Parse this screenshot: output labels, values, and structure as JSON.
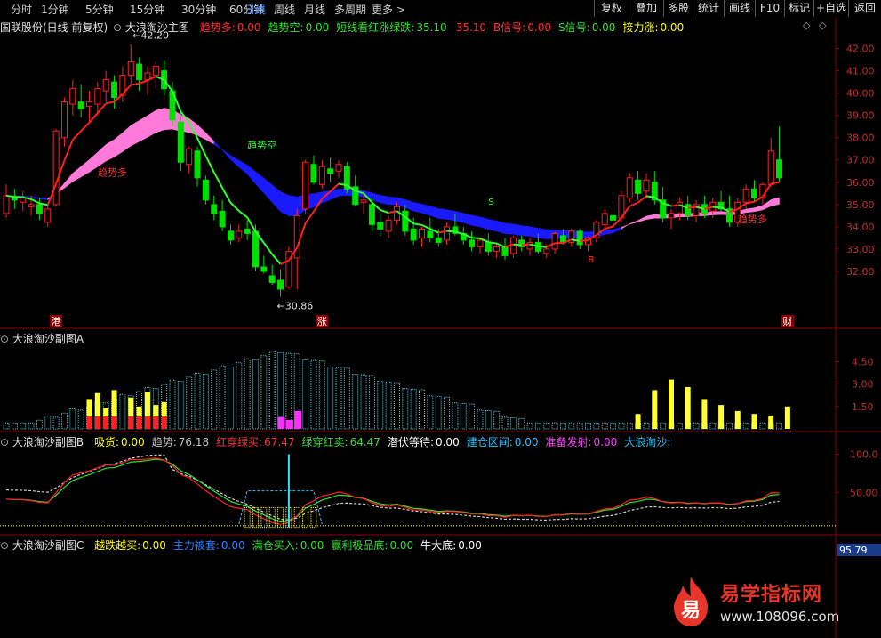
{
  "toolbar": {
    "periods": [
      "分时",
      "1分钟",
      "5分钟",
      "15分钟",
      "30分钟",
      "60分钟",
      "日线",
      "周线",
      "月线",
      "多周期",
      "更多 >"
    ],
    "active_period": "日线",
    "buttons": [
      "复权",
      "叠加",
      "多股",
      "统计",
      "画线",
      "F10",
      "标记",
      "+自选",
      "返回"
    ]
  },
  "main": {
    "stock": "国联股份(日线 前复权)",
    "indicator": "大浪淘沙主图",
    "items": [
      {
        "label": "趋势多:",
        "value": "0.00",
        "color": "#ff3030"
      },
      {
        "label": "趋势空:",
        "value": "0.00",
        "color": "#30e030"
      },
      {
        "label": "短线看红涨绿跌:",
        "value": "35.10",
        "color": "#30e030"
      },
      {
        "label": "",
        "value": "35.10",
        "color": "#ff3030"
      },
      {
        "label": "B信号:",
        "value": "0.00",
        "color": "#ff3030"
      },
      {
        "label": "S信号:",
        "value": "0.00",
        "color": "#30e030"
      },
      {
        "label": "接力涨:",
        "value": "0.00",
        "color": "#ffff00"
      }
    ],
    "price_axis": [
      "42.00",
      "41.00",
      "40.00",
      "39.00",
      "38.00",
      "37.00",
      "36.00",
      "35.00",
      "34.00",
      "33.00",
      "32.00"
    ],
    "high_label": "42.20",
    "low_label": "30.86",
    "trend_long_label": "趋势多",
    "trend_short_label": "趋势空",
    "markers": [
      "港",
      "涨",
      "财"
    ],
    "signal_s": "S",
    "signal_b": "B"
  },
  "subA": {
    "title": "大浪淘沙副图A",
    "axis": [
      "4.50",
      "3.00",
      "1.50"
    ]
  },
  "subB": {
    "title": "大浪淘沙副图B",
    "items": [
      {
        "label": "吸货:",
        "value": "0.00",
        "color": "#ffff00"
      },
      {
        "label": "趋势:",
        "value": "76.18",
        "color": "#c0c0c0"
      },
      {
        "label": "红穿绿买:",
        "value": "67.47",
        "color": "#ff3030"
      },
      {
        "label": "绿穿红卖:",
        "value": "64.47",
        "color": "#30e030"
      },
      {
        "label": "潜伏等待:",
        "value": "0.00",
        "color": "#ffffff"
      },
      {
        "label": "建仓区间:",
        "value": "0.00",
        "color": "#30c0ff"
      },
      {
        "label": "准备发射:",
        "value": "0.00",
        "color": "#ff40ff"
      },
      {
        "label": "大浪淘沙:",
        "value": "",
        "color": "#30c0ff"
      }
    ],
    "axis": [
      "100.0",
      "50.00"
    ]
  },
  "subC": {
    "title": "大浪淘沙副图C",
    "items": [
      {
        "label": "越跌越买:",
        "value": "0.00",
        "color": "#ffff00"
      },
      {
        "label": "主力被套:",
        "value": "0.00",
        "color": "#3080ff"
      },
      {
        "label": "满仓买入:",
        "value": "0.00",
        "color": "#30e030"
      },
      {
        "label": "赢利极品底:",
        "value": "0.00",
        "color": "#30e030"
      },
      {
        "label": "牛大底:",
        "value": "0.00",
        "color": "#ffffff"
      }
    ],
    "axis_value": "95.79"
  },
  "watermark": {
    "text": "易学指标网",
    "url": "www.108096.com",
    "logo_char": "易"
  },
  "candles": [
    [
      34.6,
      35.9,
      34.4,
      35.4
    ],
    [
      35.3,
      35.7,
      34.8,
      35.2
    ],
    [
      35.1,
      35.6,
      34.7,
      35.3
    ],
    [
      34.9,
      35.4,
      34.5,
      35.0
    ],
    [
      35.0,
      35.3,
      34.3,
      34.6
    ],
    [
      34.2,
      35.0,
      34.0,
      34.8
    ],
    [
      35.0,
      38.4,
      34.9,
      38.3
    ],
    [
      38.0,
      39.8,
      37.6,
      39.6
    ],
    [
      39.5,
      40.6,
      39.0,
      40.2
    ],
    [
      39.6,
      40.4,
      38.9,
      39.3
    ],
    [
      39.4,
      40.1,
      38.7,
      39.6
    ],
    [
      39.5,
      40.5,
      39.0,
      40.2
    ],
    [
      40.1,
      41.0,
      39.6,
      40.6
    ],
    [
      40.5,
      40.8,
      39.3,
      39.8
    ],
    [
      39.9,
      41.2,
      39.6,
      40.8
    ],
    [
      40.8,
      42.2,
      40.4,
      41.4
    ],
    [
      41.3,
      41.6,
      40.1,
      40.6
    ],
    [
      40.6,
      41.2,
      39.9,
      40.9
    ],
    [
      40.8,
      41.4,
      40.2,
      41.2
    ],
    [
      41.0,
      41.5,
      39.9,
      40.2
    ],
    [
      40.1,
      40.5,
      38.5,
      38.8
    ],
    [
      38.7,
      39.2,
      36.5,
      36.9
    ],
    [
      36.8,
      37.6,
      36.4,
      37.5
    ],
    [
      37.4,
      37.6,
      35.8,
      36.2
    ],
    [
      36.1,
      36.3,
      35.0,
      35.2
    ],
    [
      35.0,
      35.4,
      34.3,
      34.6
    ],
    [
      34.7,
      35.2,
      33.8,
      34.0
    ],
    [
      33.8,
      34.1,
      33.2,
      33.4
    ],
    [
      33.5,
      34.1,
      33.3,
      33.8
    ],
    [
      33.9,
      34.3,
      33.4,
      33.7
    ],
    [
      33.8,
      34.1,
      32.0,
      32.2
    ],
    [
      32.2,
      32.7,
      31.9,
      32.0
    ],
    [
      31.8,
      32.3,
      31.4,
      31.5
    ],
    [
      31.6,
      32.1,
      30.86,
      31.2
    ],
    [
      31.3,
      33.1,
      31.2,
      32.9
    ],
    [
      32.6,
      34.8,
      31.2,
      34.5
    ],
    [
      34.8,
      37.0,
      34.6,
      36.9
    ],
    [
      36.8,
      37.2,
      35.9,
      36.0
    ],
    [
      35.9,
      37.0,
      35.7,
      36.7
    ],
    [
      36.6,
      37.1,
      36.0,
      36.4
    ],
    [
      36.5,
      37.0,
      36.2,
      36.8
    ],
    [
      36.7,
      36.9,
      35.5,
      35.7
    ],
    [
      35.8,
      36.3,
      34.9,
      35.0
    ],
    [
      35.1,
      35.6,
      34.6,
      35.2
    ],
    [
      35.0,
      35.3,
      33.8,
      34.1
    ],
    [
      34.2,
      34.6,
      33.6,
      33.9
    ],
    [
      33.8,
      34.5,
      33.5,
      34.3
    ],
    [
      34.3,
      35.1,
      34.1,
      34.9
    ],
    [
      34.7,
      35.0,
      33.6,
      33.8
    ],
    [
      33.9,
      34.4,
      33.2,
      33.4
    ],
    [
      33.5,
      34.0,
      33.1,
      33.9
    ],
    [
      33.8,
      34.4,
      33.3,
      33.5
    ],
    [
      33.5,
      33.9,
      33.1,
      33.3
    ],
    [
      33.4,
      34.2,
      33.2,
      34.0
    ],
    [
      34.0,
      34.6,
      33.6,
      33.7
    ],
    [
      33.7,
      34.0,
      33.2,
      33.4
    ],
    [
      33.4,
      33.8,
      32.9,
      33.1
    ],
    [
      33.1,
      33.5,
      32.8,
      33.4
    ],
    [
      33.3,
      33.7,
      32.7,
      32.9
    ],
    [
      32.9,
      33.3,
      32.6,
      33.1
    ],
    [
      33.1,
      33.5,
      32.5,
      32.7
    ],
    [
      32.8,
      33.6,
      32.6,
      33.5
    ],
    [
      33.4,
      33.6,
      32.9,
      33.1
    ],
    [
      33.0,
      33.5,
      32.7,
      33.3
    ],
    [
      33.3,
      33.7,
      32.8,
      32.9
    ],
    [
      32.8,
      33.2,
      32.6,
      33.0
    ],
    [
      33.0,
      33.8,
      32.8,
      33.7
    ],
    [
      33.6,
      33.9,
      33.2,
      33.3
    ],
    [
      33.3,
      33.9,
      33.1,
      33.8
    ],
    [
      33.8,
      33.9,
      33.0,
      33.2
    ],
    [
      33.2,
      33.6,
      32.9,
      33.5
    ],
    [
      33.5,
      34.3,
      33.3,
      34.2
    ],
    [
      34.1,
      34.8,
      33.9,
      34.6
    ],
    [
      34.5,
      35.0,
      34.0,
      34.3
    ],
    [
      34.4,
      35.6,
      34.2,
      35.4
    ],
    [
      35.3,
      36.4,
      35.1,
      36.2
    ],
    [
      36.1,
      36.5,
      35.2,
      35.5
    ],
    [
      35.6,
      36.4,
      35.3,
      36.1
    ],
    [
      36.0,
      36.5,
      35.0,
      35.2
    ],
    [
      35.2,
      35.8,
      34.2,
      34.4
    ],
    [
      34.4,
      34.8,
      33.9,
      34.6
    ],
    [
      34.6,
      35.3,
      34.3,
      35.1
    ],
    [
      35.0,
      35.4,
      34.3,
      34.5
    ],
    [
      34.5,
      35.2,
      34.2,
      35.0
    ],
    [
      35.0,
      35.4,
      34.4,
      34.6
    ],
    [
      34.7,
      35.3,
      34.4,
      35.1
    ],
    [
      35.1,
      35.6,
      34.7,
      34.8
    ],
    [
      34.8,
      35.4,
      34.0,
      34.2
    ],
    [
      34.2,
      35.3,
      34.0,
      35.1
    ],
    [
      35.1,
      35.9,
      34.8,
      35.7
    ],
    [
      35.7,
      36.1,
      35.1,
      35.3
    ],
    [
      35.3,
      36.0,
      34.9,
      35.9
    ],
    [
      35.9,
      38.0,
      35.8,
      37.4
    ],
    [
      37.0,
      38.5,
      36.0,
      36.2
    ]
  ]
}
